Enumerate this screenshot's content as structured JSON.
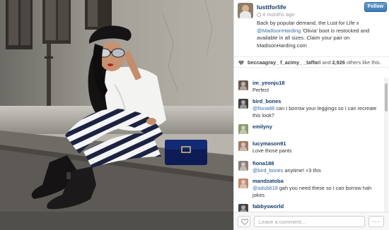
{
  "post": {
    "username": "lusttforlife",
    "time": "4 months ago",
    "follow_label": "Follow",
    "caption_before": "Back by popular demand, the Lust for Life x ",
    "caption_mention": "@MadisonHarding",
    "caption_after": " 'Olivia' boot is restocked and available in all sizes. Claim your pair on MadisonHarding.com"
  },
  "likes": {
    "names": "beccaagray_  f_azimy_  _taffari",
    "and": " and ",
    "count": "2,926",
    "suffix": " others like this."
  },
  "comments": [
    {
      "user": "im_yeonju18",
      "text": "Perfect",
      "color": "#6c5a4c"
    },
    {
      "user": "bird_bones",
      "text": "@fiona88 can I borrow your leggings so I can recreate this look?",
      "color": "#3f3f3f"
    },
    {
      "user": "emilyny",
      "text": "",
      "color": "#8b9a6a"
    },
    {
      "user": "lucymason91",
      "text": "Love those pants",
      "color": "#a07a66"
    },
    {
      "user": "fiona188",
      "text": "@bird_bones anytime! <3 this",
      "color": "#8a7f78"
    },
    {
      "user": "mandzatoba",
      "text": "@adub618 gah you need these so I can borrow hah jokes",
      "color": "#c08a70"
    },
    {
      "user": "fabbysworld",
      "text": "",
      "color": "#444444"
    }
  ],
  "footer": {
    "comment_placeholder": "Leave a comment...",
    "more_label": "..."
  },
  "colors": {
    "username": "#12396a",
    "mention": "#3b6ea8",
    "follow": "#3c78b5"
  }
}
